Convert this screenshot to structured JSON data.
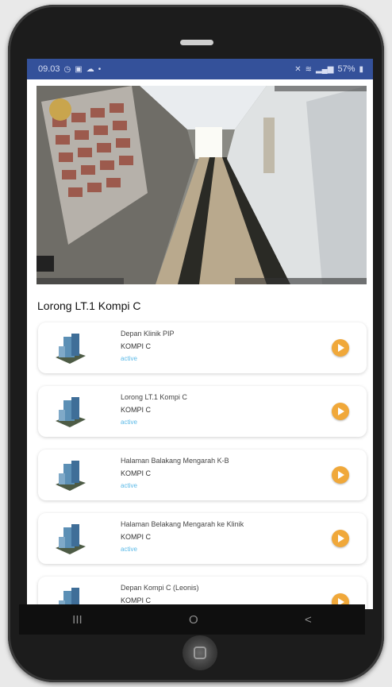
{
  "status_bar": {
    "time": "09.03",
    "left_icons": [
      "alarm-icon",
      "image-icon",
      "cloud-icon",
      "dot-icon"
    ],
    "right_text": "57%",
    "right_icons": [
      "mute-icon",
      "wifi-icon",
      "signal-icon",
      "battery-icon"
    ]
  },
  "camera": {
    "title": "Lorong LT.1 Kompi C"
  },
  "devices": [
    {
      "title": "Depan Klinik PIP",
      "group": "KOMPI C",
      "status": "active"
    },
    {
      "title": "Lorong LT.1 Kompi C",
      "group": "KOMPI C",
      "status": "active"
    },
    {
      "title": "Halaman Balakang Mengarah K-B",
      "group": "KOMPI C",
      "status": "active"
    },
    {
      "title": "Halaman Belakang Mengarah ke Klinik",
      "group": "KOMPI C",
      "status": "active"
    },
    {
      "title": "Depan Kompi  C (Leonis)",
      "group": "KOMPI C",
      "status": ""
    }
  ],
  "nav": {
    "recent": "III",
    "home": "O",
    "back": "<"
  },
  "colors": {
    "status_bar": "#34519a",
    "accent_play": "#f0a83a",
    "active_status": "#5ab9e7"
  }
}
